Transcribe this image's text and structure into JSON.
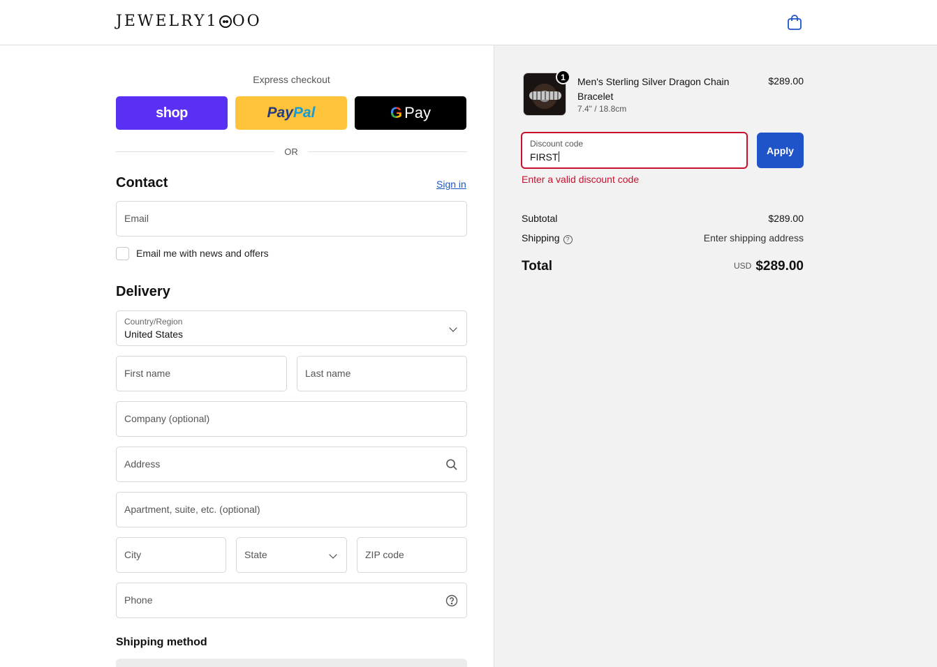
{
  "header": {
    "logo_text_1": "JEWELRY1",
    "logo_text_2": "OO"
  },
  "express": {
    "title": "Express checkout",
    "shop_label": "shop",
    "paypal_label_1": "Pay",
    "paypal_label_2": "Pal",
    "gpay_g": "G",
    "gpay_label": "Pay",
    "or_label": "OR"
  },
  "contact": {
    "heading": "Contact",
    "sign_in": "Sign in",
    "email_placeholder": "Email",
    "news_label": "Email me with news and offers"
  },
  "delivery": {
    "heading": "Delivery",
    "country_label": "Country/Region",
    "country_value": "United States",
    "first_name": "First name",
    "last_name": "Last name",
    "company": "Company (optional)",
    "address": "Address",
    "apartment": "Apartment, suite, etc. (optional)",
    "city": "City",
    "state": "State",
    "zip": "ZIP code",
    "phone": "Phone"
  },
  "shipping_method": {
    "heading": "Shipping method"
  },
  "order": {
    "quantity": "1",
    "product_name": "Men's Sterling Silver Dragon Chain Bracelet",
    "variant": "7.4\" / 18.8cm",
    "price": "$289.00",
    "discount_label": "Discount code",
    "discount_value": "FIRST",
    "apply_label": "Apply",
    "error": "Enter a valid discount code",
    "subtotal_label": "Subtotal",
    "subtotal_value": "$289.00",
    "shipping_label": "Shipping",
    "shipping_value": "Enter shipping address",
    "total_label": "Total",
    "currency": "USD",
    "total_value": "$289.00"
  },
  "colors": {
    "shop": "#5a31f4",
    "paypal": "#ffc439",
    "apply": "#1f53c9",
    "error": "#c8102e",
    "link": "#1a56c5"
  }
}
